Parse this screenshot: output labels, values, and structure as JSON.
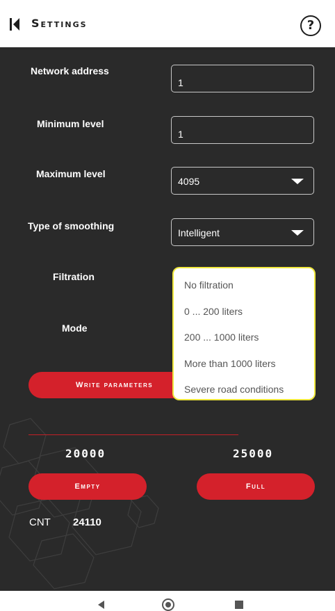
{
  "header": {
    "title": "Settings",
    "help_label": "?"
  },
  "form": {
    "network_address": {
      "label": "Network address",
      "value": "1"
    },
    "minimum_level": {
      "label": "Minimum level",
      "value": "1"
    },
    "maximum_level": {
      "label": "Maximum level",
      "value": "4095"
    },
    "smoothing": {
      "label": "Type of smoothing",
      "value": "Intelligent"
    },
    "filtration": {
      "label": "Filtration"
    },
    "mode": {
      "label": "Mode"
    },
    "write_button": "Write parameters"
  },
  "calibration": {
    "empty_value": "20000",
    "full_value": "25000",
    "empty_button": "Empty",
    "full_button": "Full",
    "cnt_label": "CNT",
    "cnt_value": "24110"
  },
  "filtration_dropdown": {
    "options": [
      "No filtration",
      "0 ... 200 liters",
      "200 ... 1000 liters",
      "More than 1000 liters",
      "Severe road conditions"
    ]
  },
  "colors": {
    "accent": "#d4212b",
    "panel_bg": "#2a2a2a",
    "highlight": "#f0e83c"
  },
  "icons": [
    "back-arrow-icon",
    "help-icon",
    "chevron-down-icon",
    "nav-back-icon",
    "nav-home-icon",
    "nav-recent-icon"
  ]
}
